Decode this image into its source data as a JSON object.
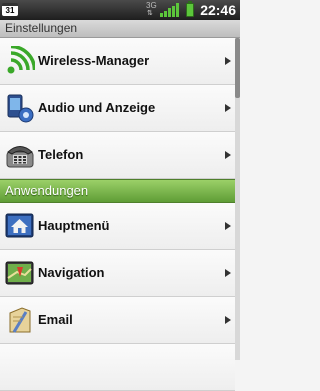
{
  "status_bar": {
    "calendar_day": "31",
    "network_label": "3G",
    "clock": "22:46",
    "icons": [
      "calendar-icon",
      "network-arrows-icon",
      "signal-icon",
      "battery-icon"
    ]
  },
  "title_bar": {
    "title": "Einstellungen"
  },
  "settings_items": [
    {
      "label": "Wireless-Manager",
      "icon": "wireless-icon"
    },
    {
      "label": "Audio und Anzeige",
      "icon": "audio-display-icon"
    },
    {
      "label": "Telefon",
      "icon": "telephone-icon"
    }
  ],
  "section_header": {
    "label": "Anwendungen"
  },
  "app_items": [
    {
      "label": "Hauptmenü",
      "icon": "home-icon"
    },
    {
      "label": "Navigation",
      "icon": "navigation-icon"
    },
    {
      "label": "Email",
      "icon": "email-icon"
    }
  ],
  "colors": {
    "section_green": "#7bbb4b",
    "status_bar": "#2a2a2a",
    "battery_green": "#5cc63b"
  }
}
